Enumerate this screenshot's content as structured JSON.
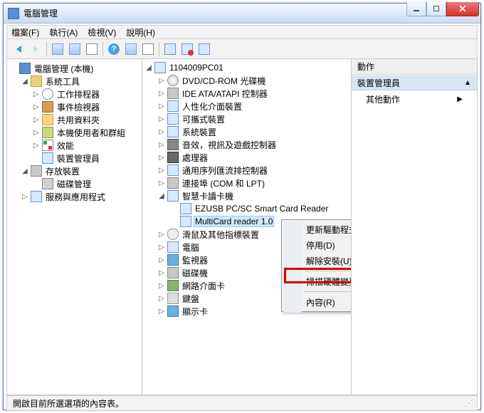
{
  "title": "電腦管理",
  "menu": {
    "file": "檔案(F)",
    "action": "執行(A)",
    "view": "檢視(V)",
    "help": "說明(H)"
  },
  "left": {
    "root": "電腦管理 (本機)",
    "sys_tools": "系統工具",
    "task_sched": "工作排程器",
    "event_viewer": "事件檢視器",
    "shared_folders": "共用資料夾",
    "local_users": "本機使用者和群組",
    "performance": "效能",
    "device_mgr": "裝置管理員",
    "storage": "存放裝置",
    "disk_mgmt": "磁碟管理",
    "services_apps": "服務與應用程式"
  },
  "mid": {
    "root": "1104009PC01",
    "dvd": "DVD/CD-ROM 光碟機",
    "ide": "IDE ATA/ATAPI 控制器",
    "hid": "人性化介面裝置",
    "portable": "可攜式裝置",
    "sysdev": "系統裝置",
    "sound": "音效，視訊及遊戲控制器",
    "cpu": "處理器",
    "usb": "通用序列匯流排控制器",
    "com": "連接埠 (COM 和 LPT)",
    "smartcard": "智慧卡讀卡機",
    "sc1": "EZUSB PC/SC Smart Card Reader",
    "sc2": "MultiCard reader 1.0",
    "mouse": "滑鼠及其他指標裝置",
    "computer": "電腦",
    "monitor": "監視器",
    "disk": "磁碟機",
    "net": "網路介面卡",
    "kbd": "鍵盤",
    "display": "顯示卡"
  },
  "ctx": {
    "update": "更新驅動程式軟體(P)...",
    "disable": "停用(D)",
    "uninstall": "解除安裝(U)",
    "scan": "掃描硬體變更(A)",
    "prop": "內容(R)"
  },
  "right": {
    "header": "動作",
    "section": "裝置管理員",
    "more": "其他動作"
  },
  "status": "開啟目前所選選項的內容表。"
}
